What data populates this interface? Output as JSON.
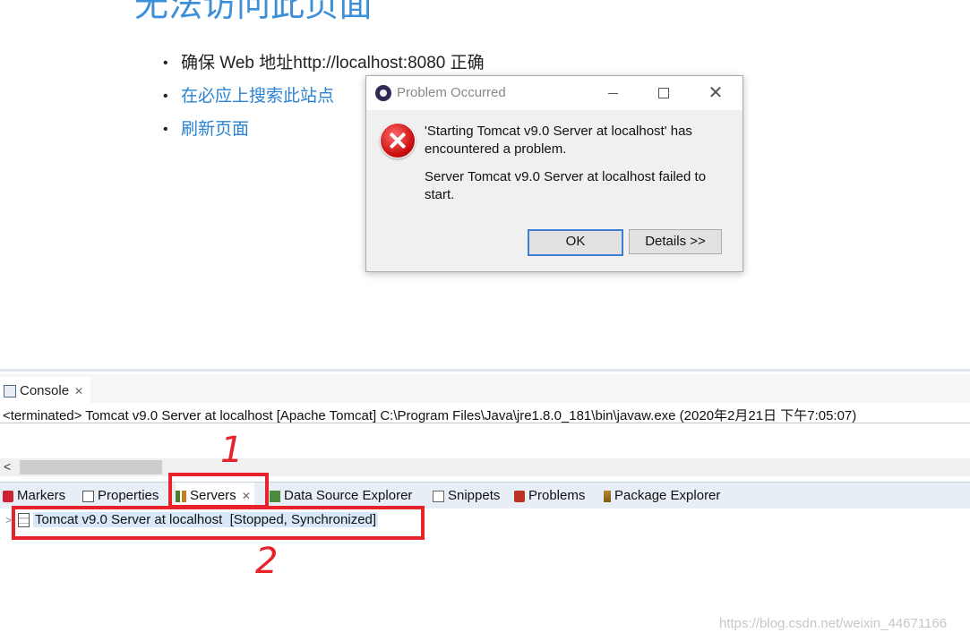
{
  "browser": {
    "error_title": "无法访问此页面",
    "bullets": [
      "确保 Web 地址http://localhost:8080 正确",
      "在必应上搜索此站点",
      "刷新页面"
    ]
  },
  "dialog": {
    "title": "Problem Occurred",
    "message_1": "'Starting Tomcat v9.0 Server at localhost' has encountered a problem.",
    "message_2": "Server Tomcat v9.0 Server at localhost failed to start.",
    "ok_label": "OK",
    "details_label": "Details >>",
    "close_glyph": "✕"
  },
  "console": {
    "tab_label": "Console",
    "close_glyph": "✕",
    "output_line": "<terminated> Tomcat v9.0 Server at localhost [Apache Tomcat] C:\\Program Files\\Java\\jre1.8.0_181\\bin\\javaw.exe (2020年2月21日 下午7:05:07)",
    "scroll_left_glyph": "<"
  },
  "tabs": {
    "markers": "Markers",
    "properties": "Properties",
    "servers": "Servers",
    "servers_close": "✕",
    "data_source_explorer": "Data Source Explorer",
    "snippets": "Snippets",
    "problems": "Problems",
    "package_explorer": "Package Explorer"
  },
  "servers": {
    "chevron": ">",
    "row_name": "Tomcat v9.0 Server at localhost",
    "row_status": "[Stopped, Synchronized]"
  },
  "annotations": {
    "number_1": "1",
    "number_2": "2",
    "color": "#e8222b"
  },
  "watermark": "https://blog.csdn.net/weixin_44671166"
}
